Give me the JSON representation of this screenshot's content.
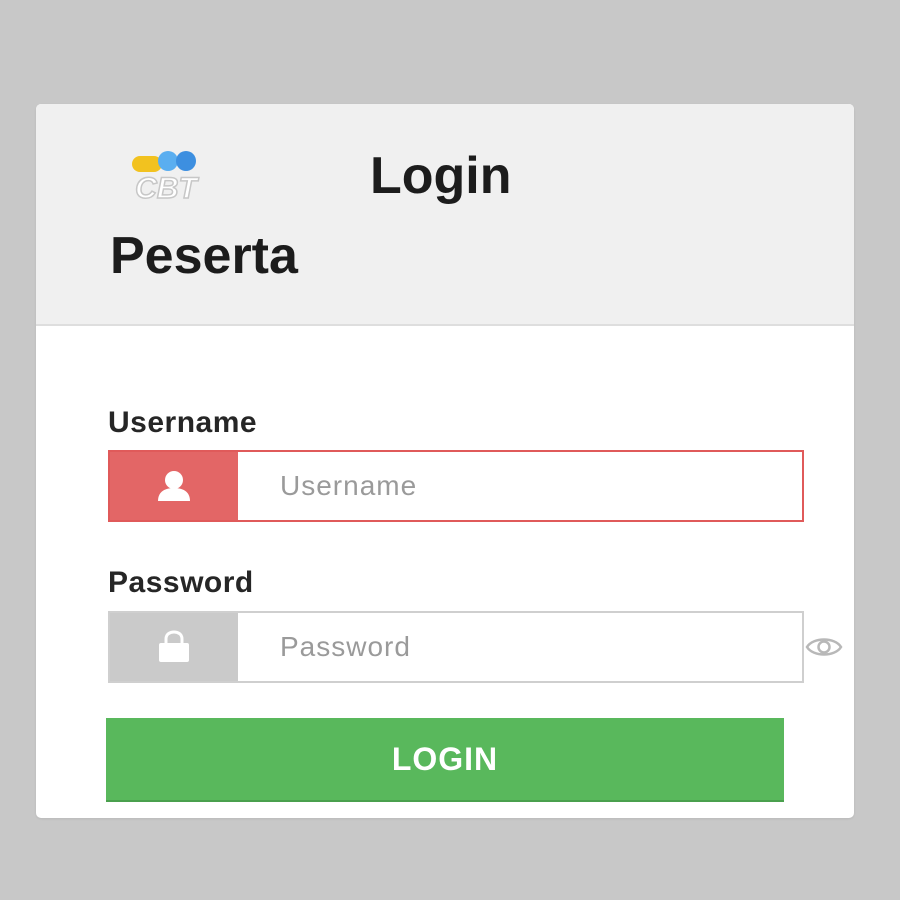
{
  "header": {
    "logo_text": "CBT",
    "title_line1": "Login",
    "title_line2": "Peserta"
  },
  "form": {
    "username": {
      "label": "Username",
      "placeholder": "Username",
      "value": "",
      "icon": "user-icon",
      "addon_color": "#e36666",
      "border_color": "#e05a5a"
    },
    "password": {
      "label": "Password",
      "placeholder": "Password",
      "value": "",
      "icon": "lock-icon",
      "toggle_icon": "eye-icon",
      "addon_color": "#cacaca"
    },
    "submit_label": "LOGIN",
    "submit_color": "#59b85c"
  }
}
